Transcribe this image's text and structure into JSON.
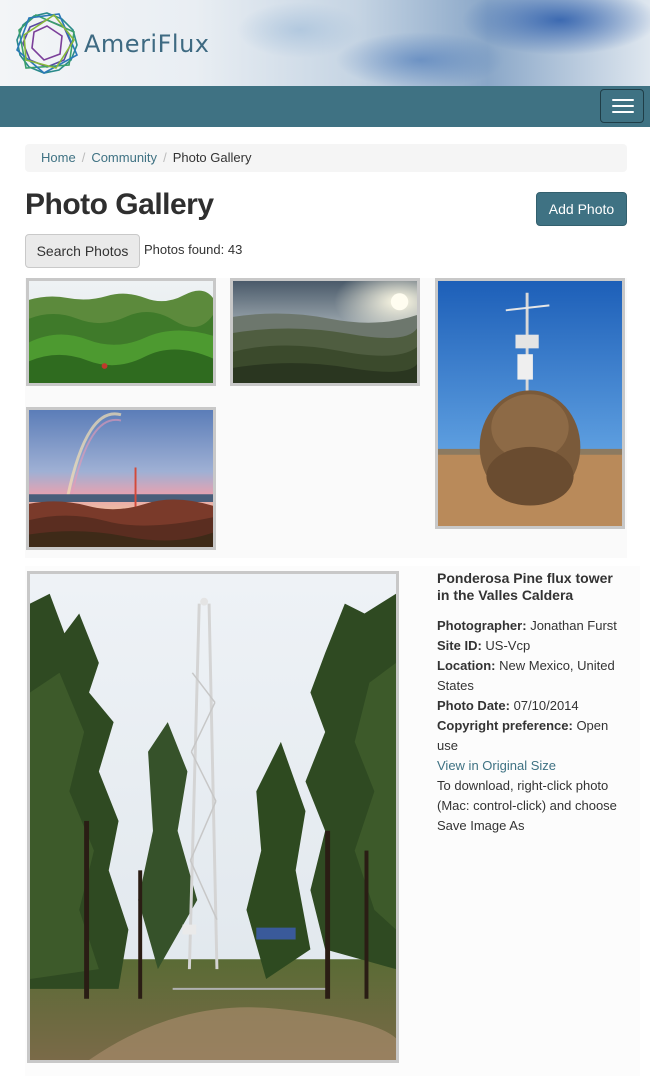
{
  "header": {
    "logo_text": "AmeriFlux",
    "logo_icon": "ameriflux-polygon-logo-icon",
    "menu_icon": "hamburger-menu-icon"
  },
  "breadcrumb": {
    "items": [
      "Home",
      "Community",
      "Photo Gallery"
    ]
  },
  "page": {
    "title": "Photo Gallery",
    "add_photo_label": "Add Photo",
    "search_label": "Search Photos",
    "found_label": "Photos found: 43"
  },
  "selected_photo": {
    "title": "Ponderosa Pine flux tower in the Valles Caldera",
    "photographer_label": "Photographer:",
    "photographer": "Jonathan Furst",
    "site_label": "Site ID:",
    "site": "US-Vcp",
    "location_label": "Location:",
    "location": "New Mexico, United States",
    "date_label": "Photo Date:",
    "date": "07/10/2014",
    "copyright_label": "Copyright preference:",
    "copyright": "Open use",
    "original_link": "View in Original Size",
    "download_note": "To download, right-click photo (Mac: control-click) and choose Save Image As"
  },
  "colors": {
    "brand": "#3f7283",
    "link": "#3f7283"
  }
}
